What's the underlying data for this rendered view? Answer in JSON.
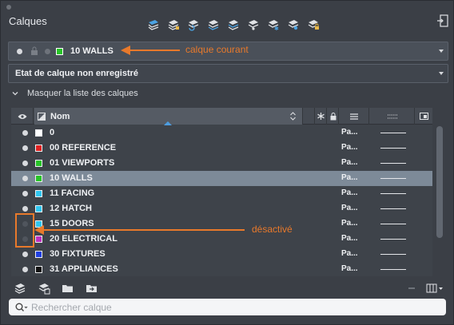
{
  "panel": {
    "title": "Calques"
  },
  "toolbar": {
    "icons": [
      "new-layer-icon",
      "layer-properties-icon",
      "layer-refresh-icon",
      "layer-match-icon",
      "layer-previous-icon",
      "layer-isolate-icon",
      "layer-freeze-icon",
      "layer-off-icon",
      "layer-lock-icon"
    ]
  },
  "current_layer": {
    "name": "10 WALLS",
    "color": "#27c427"
  },
  "layer_state": {
    "value": "Etat de calque non enregistré"
  },
  "list_toggle": {
    "label": "Masquer la liste des calques"
  },
  "table": {
    "header_name": "Nom",
    "rows": [
      {
        "name": "0",
        "color": "#ffffff",
        "visible": true,
        "linetype": "Pa...",
        "selected": false
      },
      {
        "name": "00 REFERENCE",
        "color": "#e02020",
        "visible": true,
        "linetype": "Pa...",
        "selected": false
      },
      {
        "name": "01 VIEWPORTS",
        "color": "#27c427",
        "visible": true,
        "linetype": "Pa...",
        "selected": false
      },
      {
        "name": "10 WALLS",
        "color": "#27c427",
        "visible": true,
        "linetype": "Pa...",
        "selected": true
      },
      {
        "name": "11 FACING",
        "color": "#2fc6f0",
        "visible": true,
        "linetype": "Pa...",
        "selected": false
      },
      {
        "name": "12 HATCH",
        "color": "#2fc6f0",
        "visible": true,
        "linetype": "Pa...",
        "selected": false
      },
      {
        "name": "15 DOORS",
        "color": "#2fc6f0",
        "visible": false,
        "linetype": "Pa...",
        "selected": false
      },
      {
        "name": "20 ELECTRICAL",
        "color": "#c02fc0",
        "visible": false,
        "linetype": "Pa...",
        "selected": false
      },
      {
        "name": "30 FIXTURES",
        "color": "#1f3fe0",
        "visible": true,
        "linetype": "Pa...",
        "selected": false
      },
      {
        "name": "31 APPLIANCES",
        "color": "#101010",
        "visible": true,
        "linetype": "Pa...",
        "selected": false
      }
    ]
  },
  "search": {
    "placeholder": "Rechercher calque",
    "value": ""
  },
  "annotations": {
    "current": "calque courant",
    "disabled": "désactivé",
    "color": "#e8792b"
  }
}
